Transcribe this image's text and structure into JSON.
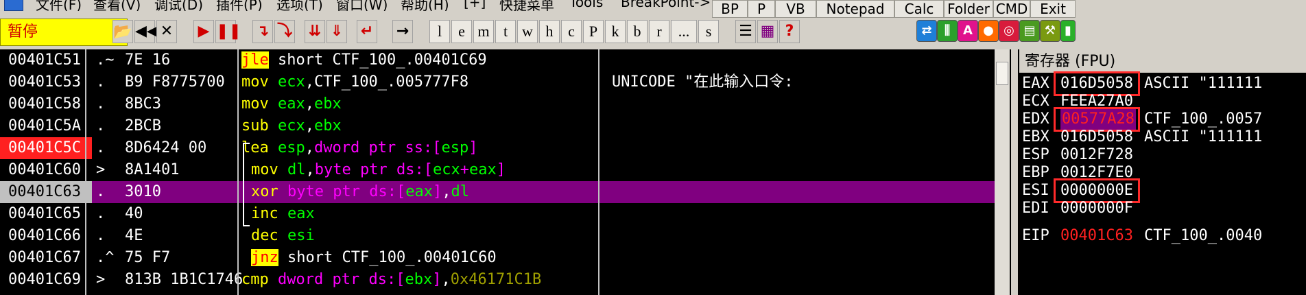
{
  "menu": {
    "items": [
      "文件(F)",
      "查看(V)",
      "调试(D)",
      "插件(P)",
      "选项(T)",
      "窗口(W)",
      "帮助(H)",
      "[+]",
      "快捷菜单",
      "Tools",
      "BreakPoint->"
    ]
  },
  "top_buttons": [
    "BP",
    "P",
    "VB",
    "Notepad",
    "Calc",
    "Folder",
    "CMD",
    "Exit"
  ],
  "status": "暂停",
  "toolbar_letters": [
    "l",
    "e",
    "m",
    "t",
    "w",
    "h",
    "c",
    "P",
    "k",
    "b",
    "r",
    "...",
    "s"
  ],
  "disasm": [
    {
      "addr": "00401C51",
      "mark": ".~",
      "hex": "7E 16",
      "mn": "jle",
      "ops": " short CTF_100_.00401C69",
      "comment": "",
      "addr_style": "normal"
    },
    {
      "addr": "00401C53",
      "mark": ".",
      "hex": "B9 F8775700",
      "mn": "mov",
      "ops": " ecx,CTF_100_.005777F8",
      "comment": "UNICODE \"在此输入口令:",
      "addr_style": "normal"
    },
    {
      "addr": "00401C58",
      "mark": ".",
      "hex": "8BC3",
      "mn": "mov",
      "ops": " eax,ebx",
      "comment": "",
      "addr_style": "normal"
    },
    {
      "addr": "00401C5A",
      "mark": ".",
      "hex": "2BCB",
      "mn": "sub",
      "ops": " ecx,ebx",
      "comment": "",
      "addr_style": "normal"
    },
    {
      "addr": "00401C5C",
      "mark": ".",
      "hex": "8D6424 00",
      "mn": "lea",
      "ops": " esp,dword ptr ss:[esp]",
      "comment": "",
      "addr_style": "breakpoint"
    },
    {
      "addr": "00401C60",
      "mark": ">",
      "hex": "8A1401",
      "mn": "mov",
      "ops": " dl,byte ptr ds:[ecx+eax]",
      "comment": "",
      "addr_style": "normal"
    },
    {
      "addr": "00401C63",
      "mark": ".",
      "hex": "3010",
      "mn": "xor",
      "ops": " byte ptr ds:[eax],dl",
      "comment": "",
      "addr_style": "current"
    },
    {
      "addr": "00401C65",
      "mark": ".",
      "hex": "40",
      "mn": "inc",
      "ops": " eax",
      "comment": "",
      "addr_style": "normal"
    },
    {
      "addr": "00401C66",
      "mark": ".",
      "hex": "4E",
      "mn": "dec",
      "ops": " esi",
      "comment": "",
      "addr_style": "normal"
    },
    {
      "addr": "00401C67",
      "mark": ".^",
      "hex": "75 F7",
      "mn": "jnz",
      "ops": " short CTF_100_.00401C60",
      "comment": "",
      "addr_style": "normal"
    },
    {
      "addr": "00401C69",
      "mark": ">",
      "hex": "813B 1B1C1746",
      "mn": "cmp",
      "ops": " dword ptr ds:[ebx],0x46171C1B",
      "comment": "",
      "addr_style": "normal"
    }
  ],
  "registers": {
    "title": "寄存器 (FPU)",
    "rows": [
      {
        "name": "EAX",
        "value": "016D5058",
        "comment": "ASCII \"111111"
      },
      {
        "name": "ECX",
        "value": "FEEA27A0",
        "comment": ""
      },
      {
        "name": "EDX",
        "value": "00577A28",
        "comment": "CTF_100_.0057"
      },
      {
        "name": "EBX",
        "value": "016D5058",
        "comment": "ASCII \"111111"
      },
      {
        "name": "ESP",
        "value": "0012F728",
        "comment": ""
      },
      {
        "name": "EBP",
        "value": "0012F7E0",
        "comment": ""
      },
      {
        "name": "ESI",
        "value": "0000000E",
        "comment": ""
      },
      {
        "name": "EDI",
        "value": "0000000F",
        "comment": ""
      },
      {
        "name": "EIP",
        "value": "00401C63",
        "comment": "CTF_100_.0040"
      }
    ]
  },
  "colors": {
    "current_line": "#800080",
    "breakpoint": "#ff2020",
    "mnemonic_jump_bg": "#ffff00",
    "mnemonic": "#ffff00",
    "register_changed": "#ff2020",
    "highlight_box": "#ff2a2a"
  }
}
